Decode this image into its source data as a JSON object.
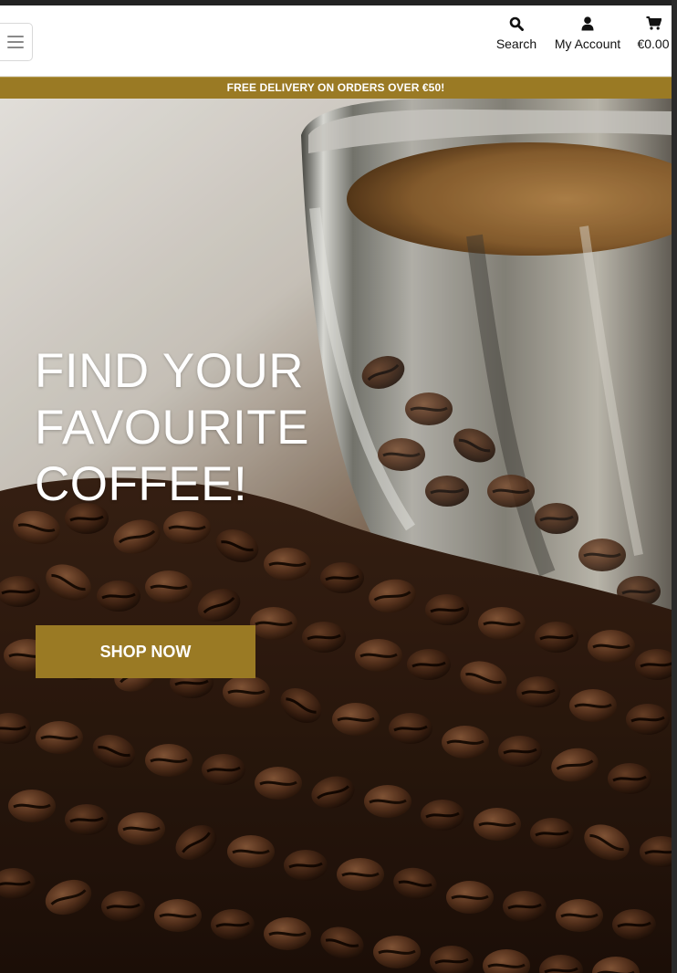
{
  "header": {
    "search_label": "Search",
    "account_label": "My Account",
    "cart_total": "€0.00"
  },
  "banner": {
    "text": "FREE DELIVERY ON ORDERS OVER €50!"
  },
  "hero": {
    "title_lines": [
      "FIND YOUR",
      "FAVOURITE",
      "COFFEE!"
    ],
    "cta_label": "SHOP NOW"
  },
  "icons": {
    "menu": "hamburger-icon",
    "search": "search-icon",
    "account": "user-icon",
    "cart": "cart-icon"
  },
  "colors": {
    "brand_gold": "#9a7a24",
    "text_dark": "#111111",
    "white": "#ffffff"
  }
}
